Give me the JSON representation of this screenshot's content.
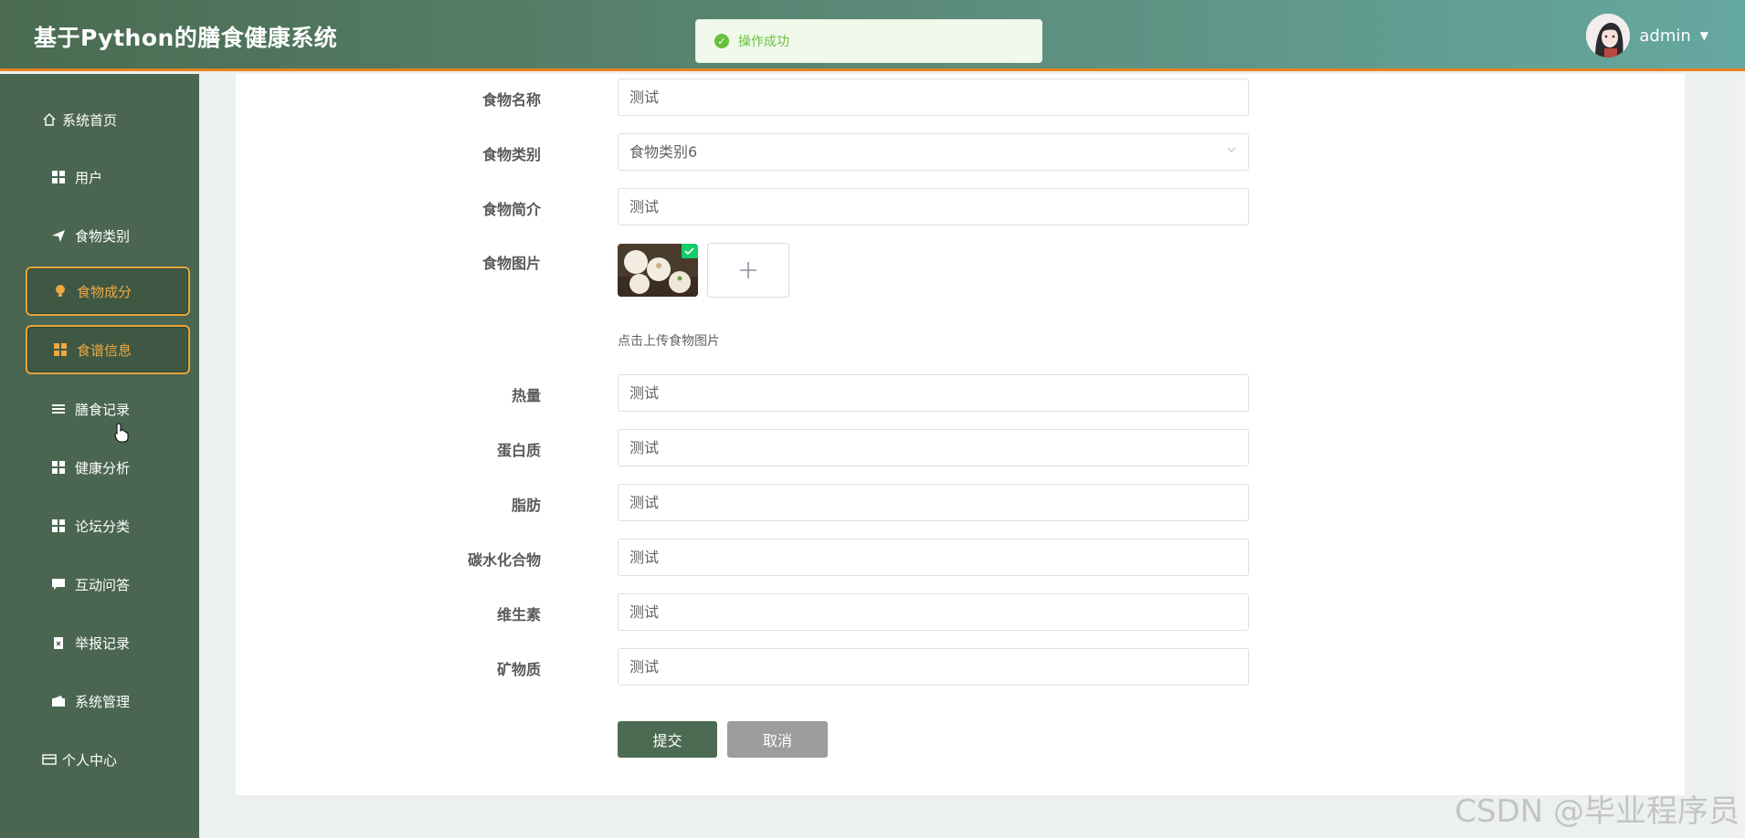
{
  "header": {
    "app_title": "基于Python的膳食健康系统",
    "user": "admin"
  },
  "toast": {
    "message": "操作成功"
  },
  "sidebar": {
    "items": [
      {
        "label": "系统首页",
        "icon": "home-icon"
      },
      {
        "label": "用户",
        "icon": "grid-icon"
      },
      {
        "label": "食物类别",
        "icon": "send-icon"
      },
      {
        "label": "食物成分",
        "icon": "bulb-icon",
        "active": true
      },
      {
        "label": "食谱信息",
        "icon": "grid-icon",
        "active": true
      },
      {
        "label": "膳食记录",
        "icon": "list-icon"
      },
      {
        "label": "健康分析",
        "icon": "grid-icon"
      },
      {
        "label": "论坛分类",
        "icon": "grid-icon"
      },
      {
        "label": "互动问答",
        "icon": "chat-icon"
      },
      {
        "label": "举报记录",
        "icon": "clipboard-icon"
      },
      {
        "label": "系统管理",
        "icon": "wallet-icon"
      },
      {
        "label": "个人中心",
        "icon": "card-icon"
      }
    ]
  },
  "form": {
    "food_name": {
      "label": "食物名称",
      "value": "测试"
    },
    "food_category": {
      "label": "食物类别",
      "value": "食物类别6"
    },
    "food_intro": {
      "label": "食物简介",
      "value": "测试"
    },
    "food_image": {
      "label": "食物图片",
      "tip": "点击上传食物图片"
    },
    "calories": {
      "label": "热量",
      "value": "测试"
    },
    "protein": {
      "label": "蛋白质",
      "value": "测试"
    },
    "fat": {
      "label": "脂肪",
      "value": "测试"
    },
    "carbs": {
      "label": "碳水化合物",
      "value": "测试"
    },
    "vitamins": {
      "label": "维生素",
      "value": "测试"
    },
    "minerals": {
      "label": "矿物质",
      "value": "测试"
    },
    "submit_label": "提交",
    "cancel_label": "取消"
  },
  "watermark": "CSDN @毕业程序员",
  "colors": {
    "header_start": "#4a6b50",
    "header_end": "#65a8a0",
    "accent": "#e5821f",
    "sidebar": "#4a6650",
    "active_text": "#f0a841",
    "submit": "#4c6b52",
    "success": "#67c23a"
  }
}
